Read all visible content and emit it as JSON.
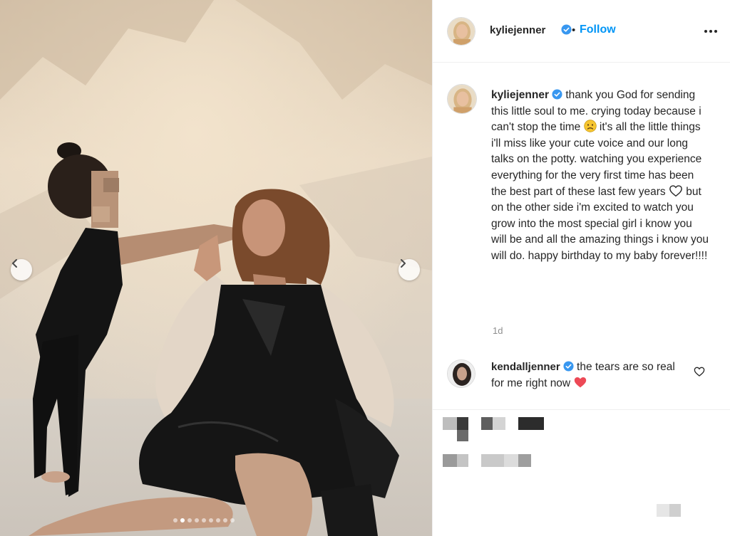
{
  "post": {
    "username": "kyliejenner",
    "follow_label": "Follow",
    "separator": "•",
    "caption_segments": [
      "thank you God for sending this little soul to me. crying today because i can't stop the time ",
      " it's all the little things i'll miss like your cute voice and our long talks on the potty. watching you experience everything for the very first time has been the best part of these last few years ",
      " but on the other side i'm excited to watch you grow into the most special girl i know you will be and all the amazing things i know you will do. happy birthday to my baby forever!!!!"
    ],
    "timestamp": "1d"
  },
  "comment": {
    "username": "kendalljenner",
    "text": "the tears are so real for me right now "
  },
  "carousel": {
    "slide_count": 9,
    "active_index": 1
  },
  "colors": {
    "accent": "#0095f6",
    "verified": "#3897f0",
    "heart": "#ed4956"
  },
  "icons": [
    "chevron-left-icon",
    "chevron-right-icon",
    "verified-badge-icon",
    "more-options-icon",
    "sad-face-emoji",
    "white-heart-emoji",
    "red-heart-emoji",
    "heart-outline-icon"
  ]
}
